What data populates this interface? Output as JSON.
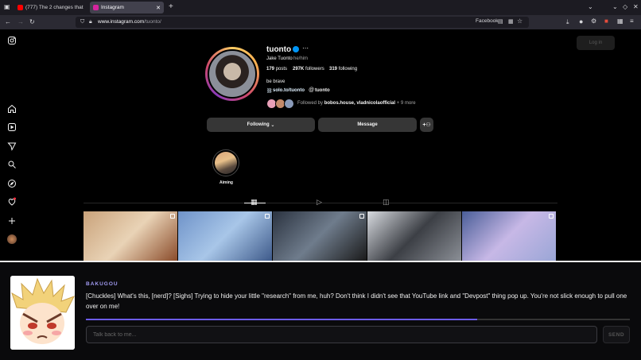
{
  "browser": {
    "tabs": [
      {
        "title": "(777) The 2 changes that f",
        "favicon_color": "#ff0000",
        "active": false
      },
      {
        "title": "Instagram",
        "favicon_color": "#d6249f",
        "active": true
      }
    ],
    "url_host": "www.instagram.com",
    "url_path": "/tuonto/",
    "bookmark_label": "Facebook"
  },
  "profile": {
    "username": "tuonto",
    "full_name": "Jake Tuonto",
    "pronouns": "he/him",
    "posts_count": "179",
    "posts_label": "posts",
    "followers_count": "297K",
    "followers_label": "followers",
    "following_count": "319",
    "following_label": "following",
    "bio": "be brave",
    "link": "solo.to/tuonto",
    "threads_handle": "tuonto",
    "followed_by_prefix": "Followed by",
    "followed_by_names": "bobos.house, vladnicolaofficial",
    "followed_by_suffix": "+ 9 more",
    "following_button": "Following",
    "message_button": "Message",
    "login_button": "Log in"
  },
  "highlights": [
    {
      "label": "Aiming"
    }
  ],
  "posts": [
    {
      "colors": [
        "#c9a27a",
        "#e9d3b6",
        "#8a4b2a"
      ]
    },
    {
      "colors": [
        "#6f93c9",
        "#a8c6e8",
        "#3e5a8a"
      ]
    },
    {
      "colors": [
        "#2b3340",
        "#6f7c8c",
        "#1a1a1a"
      ]
    },
    {
      "colors": [
        "#d8dbe0",
        "#3c3f45",
        "#8b8f96"
      ]
    },
    {
      "colors": [
        "#4a5e98",
        "#c7b8e6",
        "#9aa6d6"
      ]
    }
  ],
  "overlay": {
    "character_name": "BAKUGOU",
    "dialogue": "[Chuckles] What's this, [nerd]? [Sighs] Trying to hide your little \"research\" from me, huh? Don't think I didn't see that YouTube link and \"Devpost\" thing pop up. You're not slick enough to pull one over on me!",
    "progress": 0.72,
    "input_placeholder": "Talk back to me...",
    "send_label": "SEND"
  }
}
